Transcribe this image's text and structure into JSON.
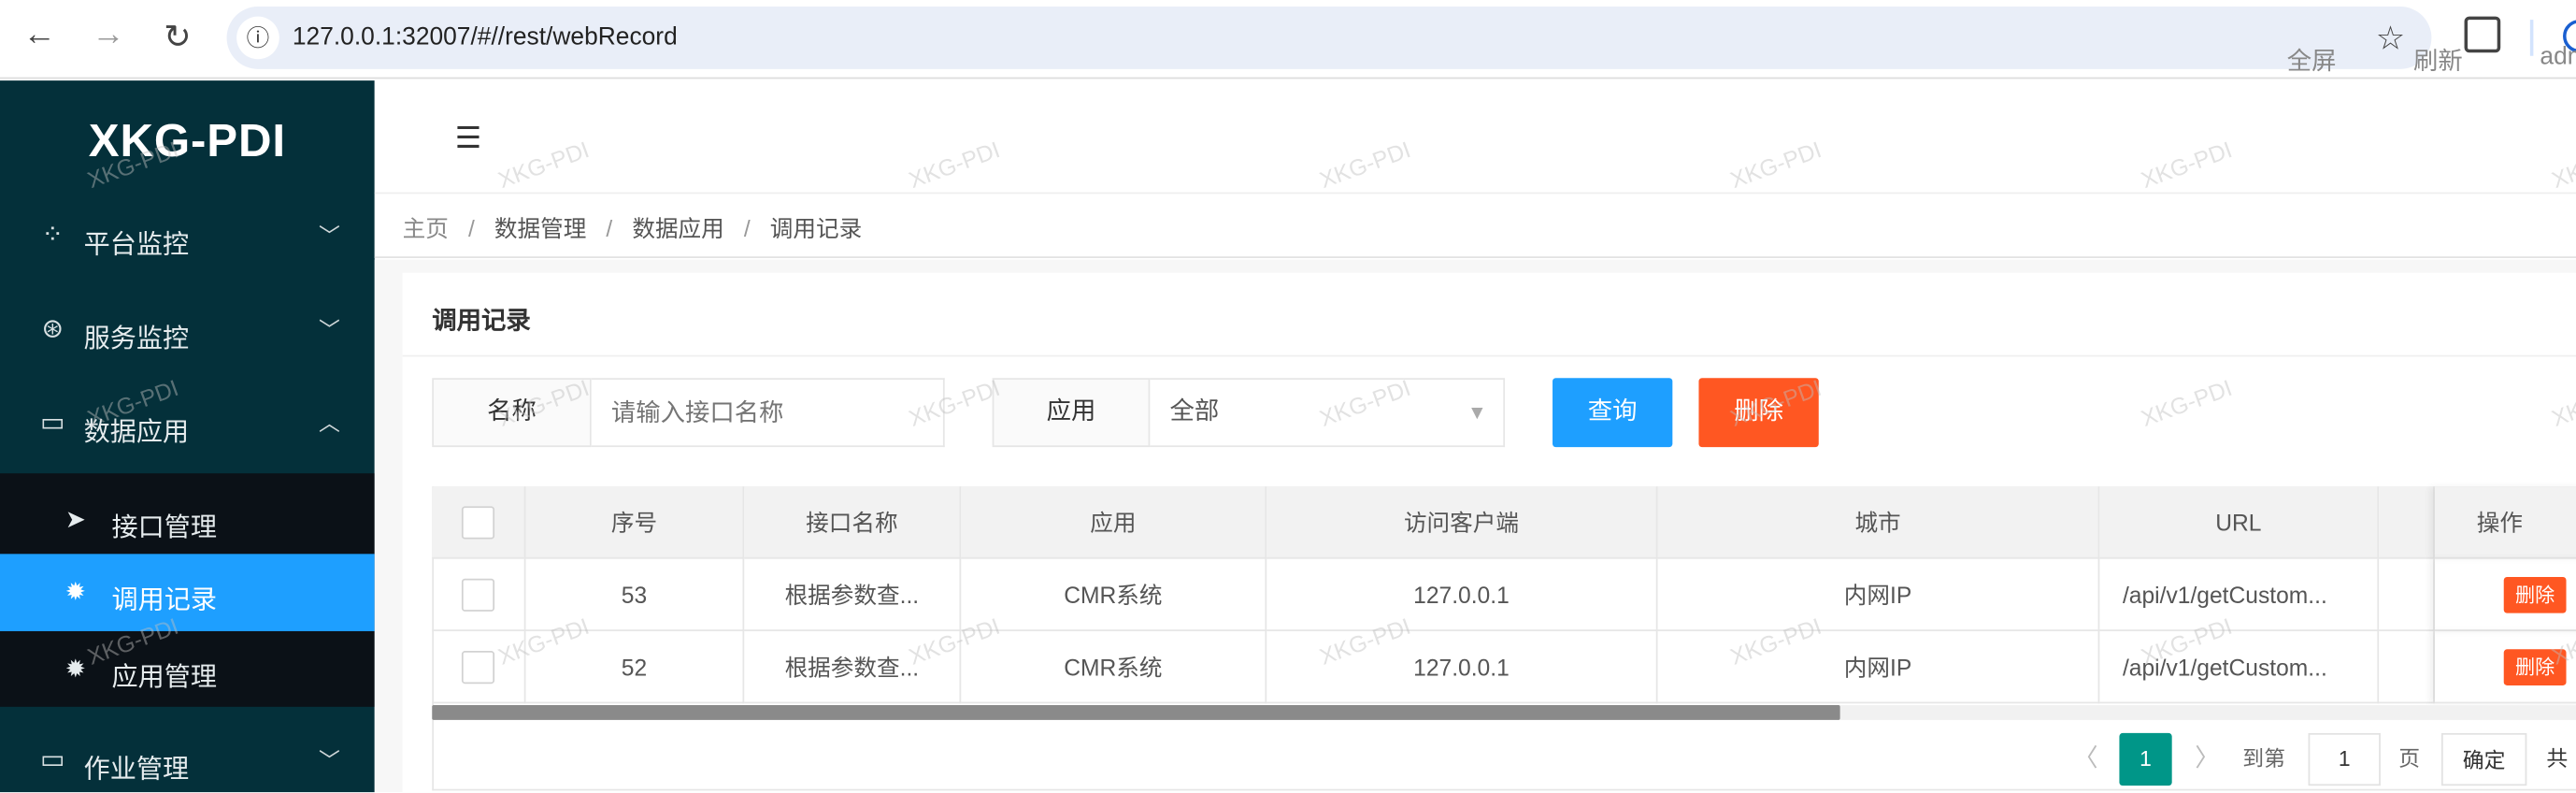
{
  "browser": {
    "url": "127.0.0.1:32007/#//rest/webRecord",
    "back": "←",
    "forward": "→",
    "reload": "↻"
  },
  "sidebar": {
    "logo": "XKG-PDI",
    "items": [
      {
        "label": "平台监控",
        "icon": "loading-dots-icon",
        "expanded": false
      },
      {
        "label": "服务监控",
        "icon": "lifebuoy-icon",
        "expanded": false
      },
      {
        "label": "数据应用",
        "icon": "laptop-icon",
        "expanded": true,
        "children": [
          {
            "label": "接口管理",
            "icon": "paper-plane-icon",
            "active": false
          },
          {
            "label": "调用记录",
            "icon": "gear-icon",
            "active": true
          },
          {
            "label": "应用管理",
            "icon": "gear-icon",
            "active": false
          }
        ]
      },
      {
        "label": "作业管理",
        "icon": "laptop-icon",
        "expanded": false
      }
    ]
  },
  "header": {
    "fullscreen": "全屏",
    "refresh": "刷新",
    "user": "admin"
  },
  "breadcrumb": [
    "主页",
    "数据管理",
    "数据应用",
    "调用记录"
  ],
  "card": {
    "title": "调用记录"
  },
  "filters": {
    "name_label": "名称",
    "name_placeholder": "请输入接口名称",
    "name_value": "",
    "app_label": "应用",
    "app_value": "全部",
    "query": "查询",
    "delete": "删除"
  },
  "table": {
    "columns": [
      "序号",
      "接口名称",
      "应用",
      "访问客户端",
      "城市",
      "URL",
      "",
      "操作"
    ],
    "rows": [
      {
        "id": "53",
        "name": "根据参数查...",
        "app": "CMR系统",
        "client": "127.0.0.1",
        "city": "内网IP",
        "url": "/api/v1/getCustom...",
        "action": "删除"
      },
      {
        "id": "52",
        "name": "根据参数查...",
        "app": "CMR系统",
        "client": "127.0.0.1",
        "city": "内网IP",
        "url": "/api/v1/getCustom...",
        "action": "删除"
      }
    ]
  },
  "pagination": {
    "prev": "〈",
    "current": "1",
    "next": "〉",
    "goto_label": "到第",
    "goto_value": "1",
    "page_suffix": "页",
    "confirm": "确定",
    "total_prefix": "共"
  },
  "watermark": "XKG-PDI",
  "colors": {
    "sidebar": "#04303a",
    "active": "#1e9fff",
    "danger": "#ff5722",
    "page": "#009688"
  }
}
